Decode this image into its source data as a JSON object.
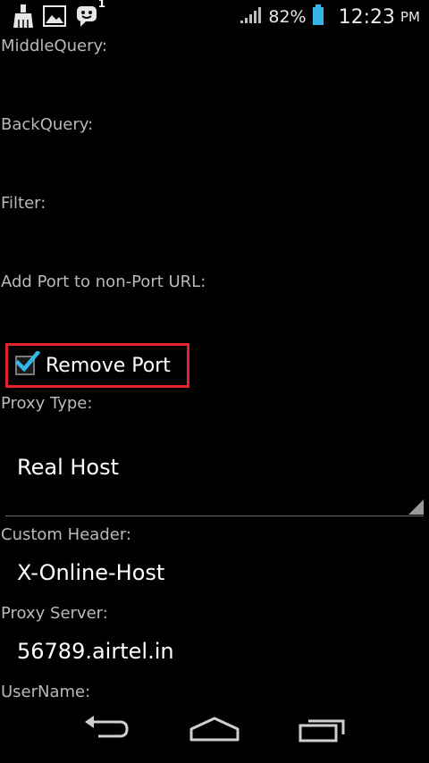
{
  "status_bar": {
    "notification_icons": [
      "cleanup-brush-icon",
      "gallery-image-icon",
      "chat-notification-icon"
    ],
    "notification_badge": "1",
    "signal_icon": "signal-bars-icon",
    "battery_percent": "82%",
    "battery_icon": "battery-icon",
    "time": "12:23",
    "ampm": "PM"
  },
  "form": {
    "middle_query_label": "MiddleQuery:",
    "back_query_label": "BackQuery:",
    "filter_label": "Filter:",
    "add_port_label": "Add Port to non-Port URL:",
    "remove_port_label": "Remove Port",
    "remove_port_checked": true,
    "proxy_type_label": "Proxy Type:",
    "proxy_type_value": "Real Host",
    "custom_header_label": "Custom Header:",
    "custom_header_value": "X-Online-Host",
    "proxy_server_label": "Proxy Server:",
    "proxy_server_value": "56789.airtel.in",
    "username_label": "UserName:"
  },
  "nav_bar": {
    "back_icon": "back-arrow-icon",
    "home_icon": "home-icon",
    "recents_icon": "recent-apps-icon"
  },
  "colors": {
    "accent_check": "#33b5e5",
    "highlight_box": "#e3222b",
    "battery": "#33b5e5"
  }
}
